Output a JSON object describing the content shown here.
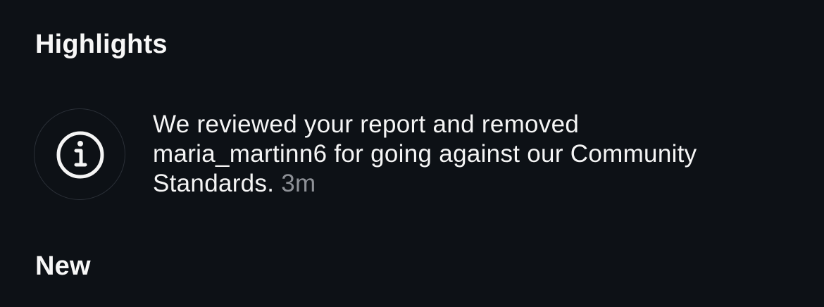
{
  "sections": {
    "highlights_title": "Highlights",
    "new_title": "New"
  },
  "notification": {
    "icon": "info-icon",
    "line1": "We reviewed your report and removed",
    "line2": "maria_martinn6 for going against our Community",
    "line3": "Standards.",
    "timestamp": "3m"
  },
  "colors": {
    "background": "#0d1116",
    "text": "#f5f5f5",
    "muted": "#8e9197",
    "icon_border": "#2a2f37"
  }
}
